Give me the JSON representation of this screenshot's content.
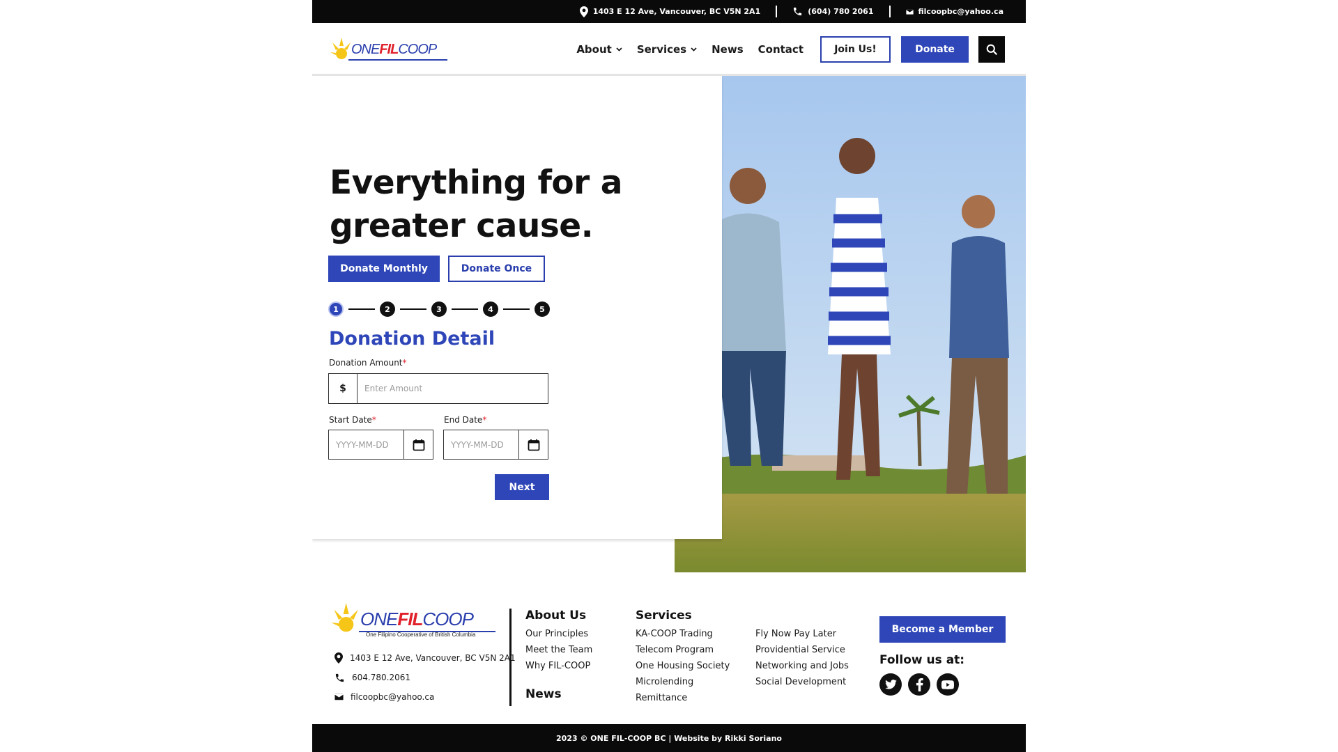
{
  "topbar": {
    "address": "1403 E 12 Ave, Vancouver, BC V5N 2A1",
    "phone": "(604) 780 2061",
    "email": "filcoopbc@yahoo.ca"
  },
  "brand": {
    "logo_word_1": "ONE",
    "logo_word_2": "FIL",
    "logo_word_3": "COOP",
    "tagline": "One Filipino Cooperative of British Columbia",
    "colors": {
      "primary": "#2e46b8",
      "logo_red": "#e0202a",
      "logo_yellow": "#f5c518",
      "dark": "#0a0a0a"
    }
  },
  "nav": {
    "items": [
      {
        "label": "About",
        "dropdown": true
      },
      {
        "label": "Services",
        "dropdown": true
      },
      {
        "label": "News",
        "dropdown": false
      },
      {
        "label": "Contact",
        "dropdown": false
      }
    ],
    "join_label": "Join Us!",
    "donate_label": "Donate",
    "search_icon": "search-icon"
  },
  "hero": {
    "title": "Everything for a greater cause.",
    "donate_monthly_label": "Donate Monthly",
    "donate_once_label": "Donate Once",
    "steps": [
      "1",
      "2",
      "3",
      "4",
      "5"
    ],
    "active_step": 1,
    "form_title": "Donation Detail",
    "amount_label": "Donation Amount",
    "currency_symbol": "$",
    "amount_placeholder": "Enter Amount",
    "start_date_label": "Start Date",
    "end_date_label": "End Date",
    "date_placeholder": "YYYY-MM-DD",
    "required_mark": "*",
    "next_label": "Next"
  },
  "footer": {
    "address": "1403 E 12 Ave, Vancouver, BC V5N 2A1",
    "phone": "604.780.2061",
    "email": "filcoopbc@yahoo.ca",
    "about": {
      "heading": "About Us",
      "links": [
        "Our Principles",
        "Meet the Team",
        "Why FIL-COOP"
      ],
      "news_label": "News"
    },
    "services": {
      "heading": "Services",
      "col1": [
        "KA-COOP Trading",
        "Telecom Program",
        "One Housing Society",
        "Microlending",
        "Remittance"
      ],
      "col2": [
        "Fly Now Pay Later",
        "Providential Service",
        "Networking and Jobs",
        "Social Development"
      ]
    },
    "become_member_label": "Become a Member",
    "follow_label": "Follow us at:",
    "socials": [
      "twitter-icon",
      "facebook-icon",
      "youtube-icon"
    ],
    "copyright": "2023 © ONE FIL-COOP BC | Website by Rikki Soriano"
  }
}
